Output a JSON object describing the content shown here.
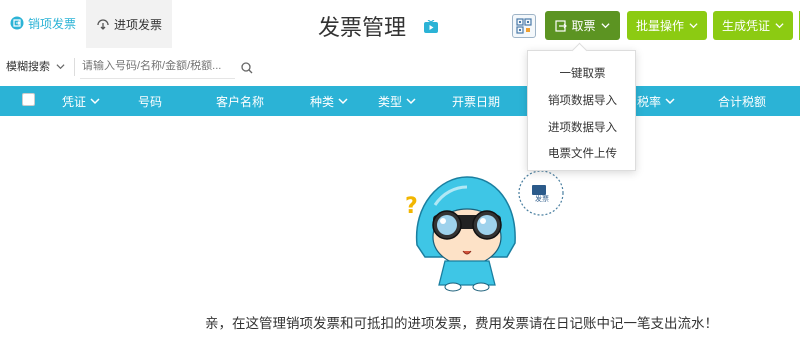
{
  "tabs": [
    {
      "label": "销项发票",
      "icon": "invoice-out-icon"
    },
    {
      "label": "进项发票",
      "icon": "invoice-in-icon"
    }
  ],
  "page_title": "发票管理",
  "toolbar": {
    "fetch_label": "取票",
    "bulk_label": "批量操作",
    "generate_label": "生成凭证"
  },
  "search": {
    "mode_label": "模糊搜索",
    "placeholder": "请输入号码/名称/金额/税额..."
  },
  "table": {
    "columns": [
      "凭证",
      "号码",
      "客户名称",
      "种类",
      "类型",
      "开票日期",
      "税率",
      "合计税额"
    ]
  },
  "fetch_menu": {
    "items": [
      "一键取票",
      "销项数据导入",
      "进项数据导入",
      "电票文件上传"
    ]
  },
  "empty_state": {
    "message": "亲，在这管理销项发票和可抵扣的进项发票，费用发票请在日记账中记一笔支出流水！",
    "bubble_text": "发票"
  },
  "colors": {
    "accent": "#2bb3d6",
    "button_dark": "#5c9422",
    "button_light": "#8ccb12"
  }
}
